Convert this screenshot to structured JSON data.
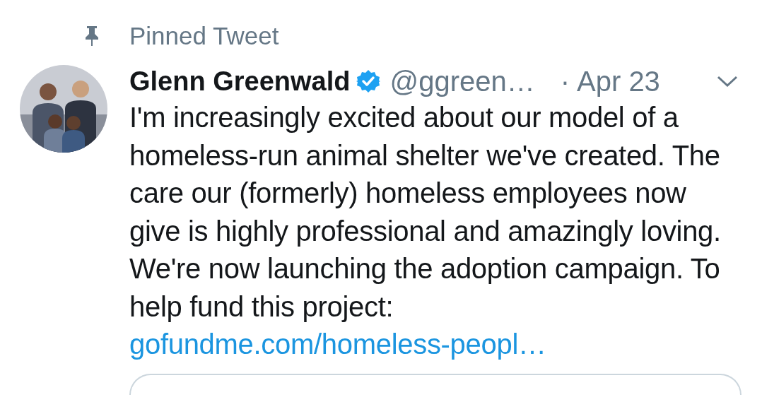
{
  "pinned_label": "Pinned Tweet",
  "tweet": {
    "author_name": "Glenn Greenwald",
    "verified": true,
    "handle": "@ggreen…",
    "separator": "·",
    "date": "Apr 23",
    "text": "I'm increasingly excited about our model of a homeless-run animal shelter we've created. The care our (formerly) homeless employees now give is highly professional and amazingly loving. We're now launching the adoption campaign. To help fund this project:",
    "link": "gofundme.com/homeless-peopl…"
  }
}
